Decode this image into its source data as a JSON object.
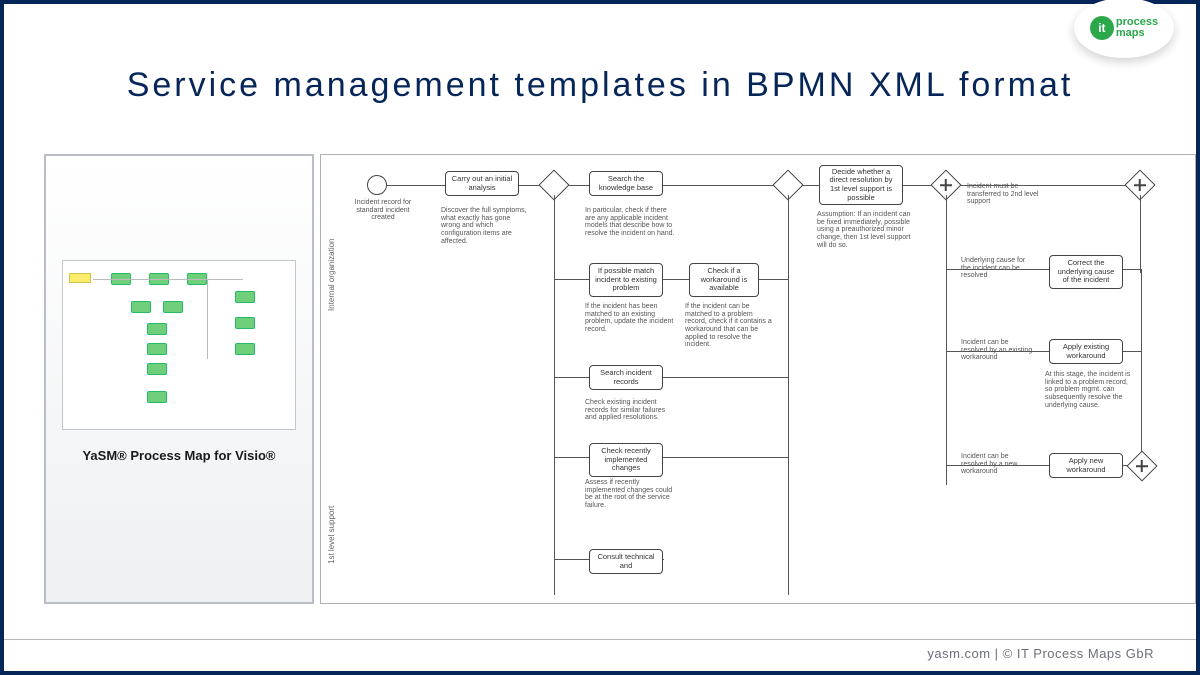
{
  "logo": {
    "it": "it",
    "line1": "process",
    "line2": "maps"
  },
  "title": "Service management templates in BPMN XML format",
  "left_caption": "YaSM®  Process Map for Visio®",
  "footer": "yasm.com | © IT Process Maps GbR",
  "diagram": {
    "lane1": "Internal organization",
    "lane2": "1st level support",
    "start_note": "Incident record for standard incident created",
    "t_analysis": "Carry out an initial analysis",
    "n_analysis": "Discover the full symptoms, what exactly has gone wrong and which configuration items are affected.",
    "t_kb": "Search the knowledge base",
    "n_kb": "In particular, check if there are any applicable incident models that describe how to resolve the incident on hand.",
    "t_match": "If possible match incident to existing problem",
    "n_match": "If the incident has been matched to an existing problem, update the incident record.",
    "t_workaround_check": "Check if a workaround is available",
    "n_workaround_check": "If the incident can be matched to a problem record, check if it contains a workaround that can be applied to resolve the incident.",
    "t_search_inc": "Search incident records",
    "n_search_inc": "Check existing incident records for similar failures and applied resolutions.",
    "t_check_changes": "Check recently implemented changes",
    "n_check_changes": "Assess if recently implemented changes could be at the root of the service failure.",
    "t_consult": "Consult technical and",
    "t_decide": "Decide whether a direct resolution by 1st level support is possible",
    "n_decide": "Assumption: If an incident can be fixed immediately, possible using a preauthorized minor change, then 1st level support will do so.",
    "lbl_transfer": "Incident must be transferred to 2nd level support",
    "lbl_underlying": "Underlying cause for the incident can be resolved",
    "lbl_existing_wa": "Incident can be resolved by an existing workaround",
    "lbl_new_wa": "Incident can be resolved by a new workaround",
    "t_correct": "Correct the underlying cause of the incident",
    "t_apply_existing": "Apply existing workaround",
    "n_apply_existing": "At this stage, the incident is linked to a problem record, so problem mgmt. can subsequently resolve the underlying cause.",
    "t_apply_new": "Apply new workaround"
  }
}
